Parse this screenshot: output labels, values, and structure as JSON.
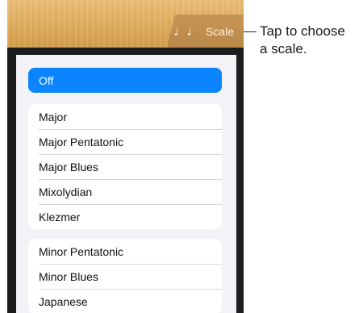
{
  "header": {
    "scale_tab": {
      "icon": "music-notes-icon",
      "icon_glyph": "♩♩",
      "label": "Scale"
    }
  },
  "callout": {
    "line1": "Tap to choose",
    "line2": "a scale."
  },
  "scale_menu": {
    "selected": "Off",
    "off_label": "Off",
    "group1": [
      "Major",
      "Major Pentatonic",
      "Major Blues",
      "Mixolydian",
      "Klezmer"
    ],
    "group2": [
      "Minor Pentatonic",
      "Minor Blues",
      "Japanese"
    ]
  },
  "colors": {
    "accent": "#0a84ff",
    "wood": "#e0ac5c",
    "panel": "#1c1c1e"
  }
}
